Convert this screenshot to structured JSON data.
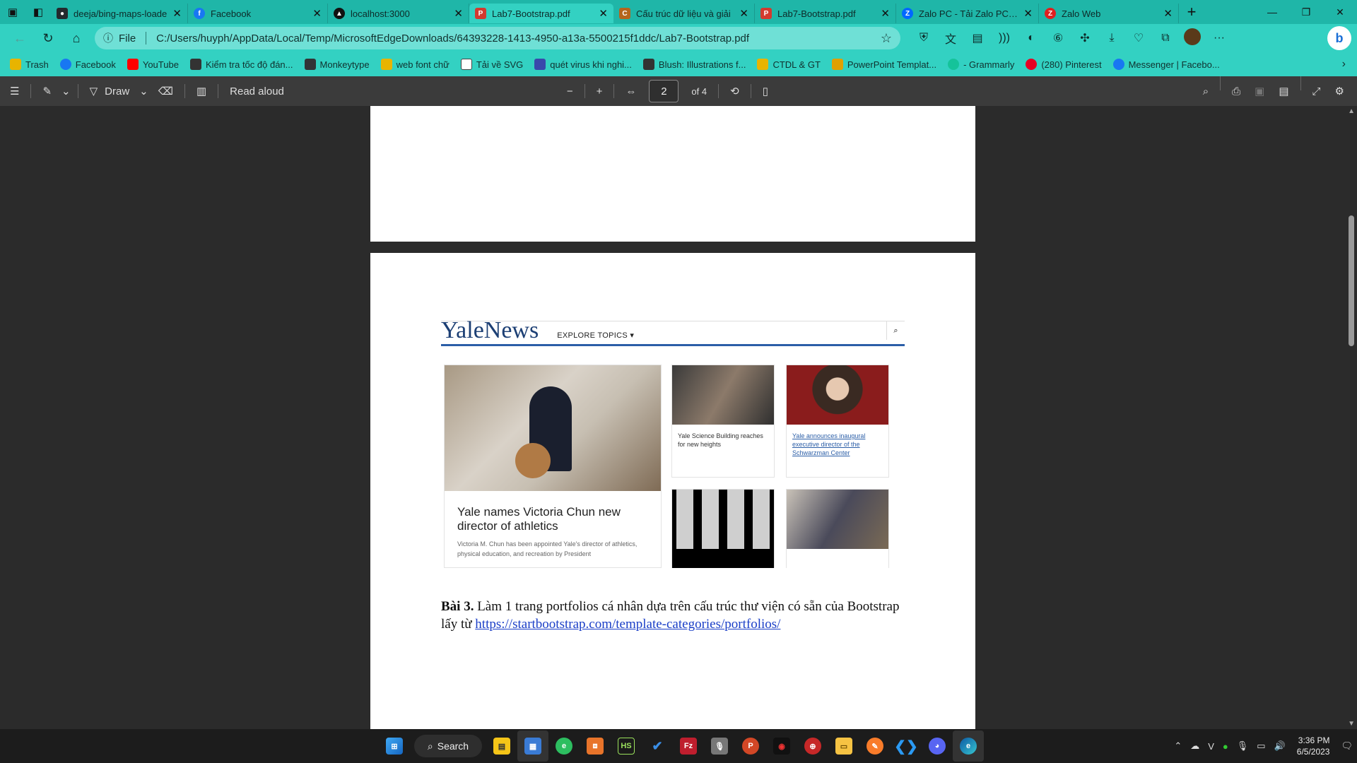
{
  "tabs": [
    {
      "label": "deeja/bing-maps-loade",
      "color": "#24292e"
    },
    {
      "label": "Facebook",
      "color": "#1877f2"
    },
    {
      "label": "localhost:3000",
      "color": "#111111"
    },
    {
      "label": "Lab7-Bootstrap.pdf",
      "color": "#d33a2f"
    },
    {
      "label": "Cấu trúc dữ liệu và giải",
      "color": "#b5651d"
    },
    {
      "label": "Lab7-Bootstrap.pdf",
      "color": "#d33a2f"
    },
    {
      "label": "Zalo PC - Tải Zalo PC dễ",
      "color": "#0068ff"
    },
    {
      "label": "Zalo Web",
      "color": "#e02020"
    }
  ],
  "address": {
    "scheme": "File",
    "url": "C:/Users/huyph/AppData/Local/Temp/MicrosoftEdgeDownloads/64393228-1413-4950-a13a-5500215f1ddc/Lab7-Bootstrap.pdf"
  },
  "bookmarks": [
    {
      "label": "Trash",
      "color": "#e8b400"
    },
    {
      "label": "Facebook",
      "color": "#1877f2"
    },
    {
      "label": "YouTube",
      "color": "#ff0000"
    },
    {
      "label": "Kiểm tra tốc độ đán...",
      "color": "#333333"
    },
    {
      "label": "Monkeytype",
      "color": "#323437"
    },
    {
      "label": "web font chữ",
      "color": "#e8b400"
    },
    {
      "label": "Tải về SVG",
      "color": "#444444"
    },
    {
      "label": "quét virus khi nghi...",
      "color": "#3949ab"
    },
    {
      "label": "Blush: Illustrations f...",
      "color": "#333333"
    },
    {
      "label": "CTDL & GT",
      "color": "#e8b400"
    },
    {
      "label": "PowerPoint Templat...",
      "color": "#e0a000"
    },
    {
      "label": "- Grammarly",
      "color": "#15c39a"
    },
    {
      "label": "(280) Pinterest",
      "color": "#e60023"
    },
    {
      "label": "Messenger | Facebo...",
      "color": "#1877f2"
    }
  ],
  "pdf_toolbar": {
    "draw_label": "Draw",
    "read_aloud_label": "Read aloud",
    "page_number": "2",
    "page_total": "of 4"
  },
  "yale": {
    "logo": "YaleNews",
    "explore": "EXPLORE TOPICS",
    "main_title": "Yale names Victoria Chun new director of athletics",
    "main_sub": "Victoria M. Chun has been appointed Yale's director of athletics, physical education, and recreation by President",
    "card1": "Yale Science Building reaches for new heights",
    "card2": "Yale announces inaugural executive director of the Schwarzman Center"
  },
  "document": {
    "bai3_label": "Bài 3.",
    "bai3_text": " Làm 1 trang portfolios cá nhân dựa trên cấu trúc thư viện có sẵn của Bootstrap lấy từ ",
    "bai3_link": "https://startbootstrap.com/template-categories/portfolios/"
  },
  "taskbar": {
    "search_label": "Search",
    "time": "3:36 PM",
    "date": "6/5/2023"
  }
}
